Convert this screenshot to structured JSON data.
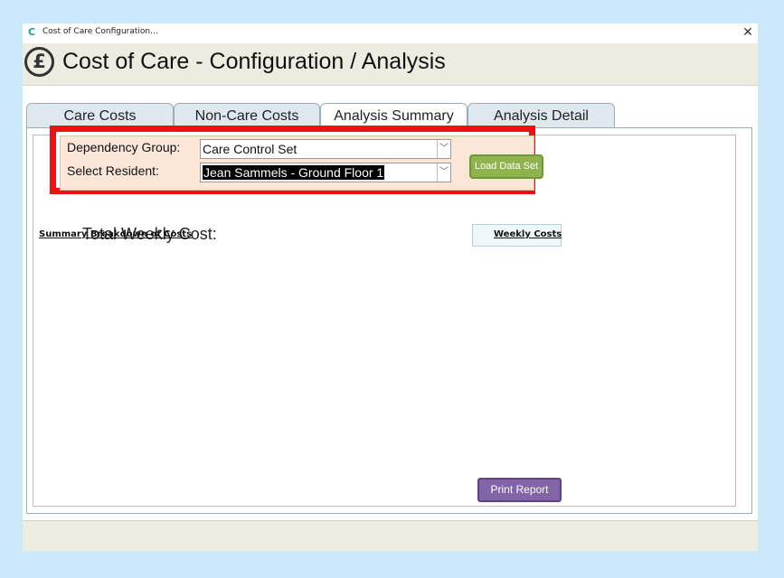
{
  "window": {
    "app_icon": "C",
    "title": "Cost of Care Configuration...",
    "close": "✕"
  },
  "header": {
    "icon_glyph": "£",
    "icon": "pound-icon",
    "title": "Cost of Care - Configuration / Analysis"
  },
  "tabs": [
    {
      "label": "Care Costs"
    },
    {
      "label": "Non-Care Costs"
    },
    {
      "label": "Analysis Summary"
    },
    {
      "label": "Analysis Detail"
    }
  ],
  "active_tab": "Analysis Summary",
  "filters": {
    "dependency_label": "Dependency Group:",
    "dependency_value": "Care Control Set",
    "resident_label": "Select Resident:",
    "resident_value": "Jean Sammels - Ground Floor 1",
    "dropdown_arrow": "﹀",
    "load_button": "Load Data Set"
  },
  "summary": {
    "total_label": "Total Weekly Cost:",
    "total_value": "",
    "breakdown_header": "Summary Breakdown of Costs",
    "weekly_header": "Weekly Costs"
  },
  "actions": {
    "print_button": "Print Report"
  },
  "colors": {
    "highlight": "#ee1111",
    "load_button": "#8fb44f",
    "print_button": "#8264a8",
    "background": "#cce8fb"
  }
}
